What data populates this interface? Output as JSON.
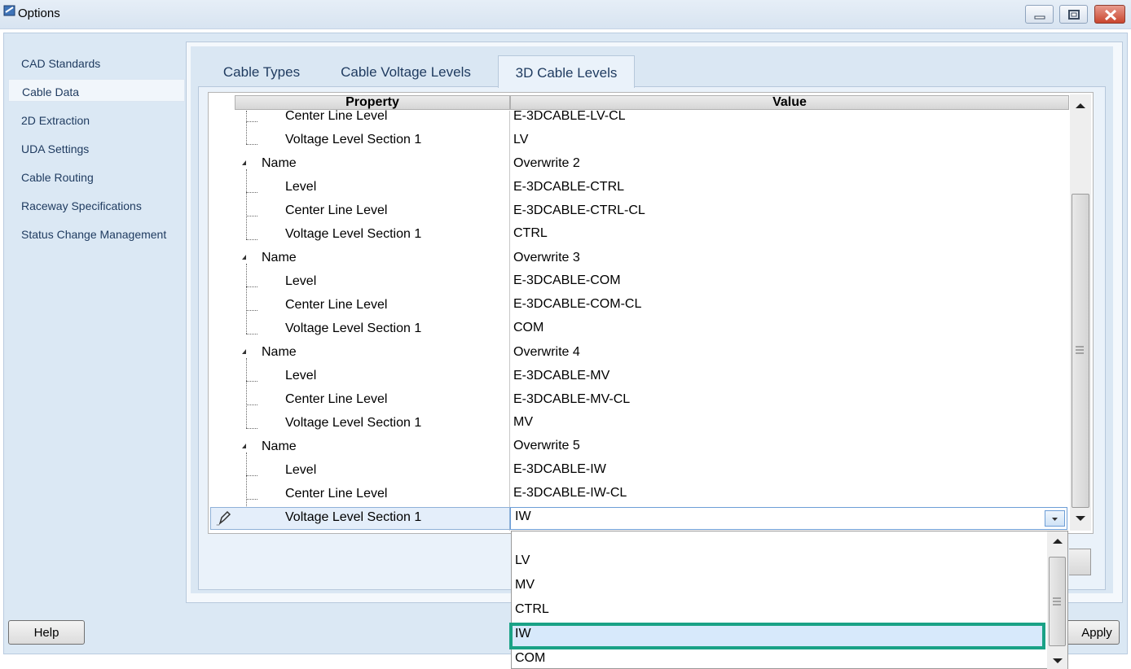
{
  "window": {
    "title": "Options",
    "icon": "app-icon",
    "controls": [
      "minimize-icon",
      "maximize-icon",
      "close-icon"
    ]
  },
  "nav": {
    "items": [
      {
        "label": "CAD Standards",
        "selected": false
      },
      {
        "label": "Cable Data",
        "selected": true
      },
      {
        "label": "2D Extraction",
        "selected": false
      },
      {
        "label": "UDA Settings",
        "selected": false
      },
      {
        "label": "Cable Routing",
        "selected": false
      },
      {
        "label": "Raceway Specifications",
        "selected": false
      },
      {
        "label": "Status Change Management",
        "selected": false
      }
    ]
  },
  "tabs": [
    {
      "label": "Cable Types",
      "active": false
    },
    {
      "label": "Cable Voltage Levels",
      "active": false
    },
    {
      "label": "3D Cable Levels",
      "active": true
    }
  ],
  "grid": {
    "headers": {
      "property": "Property",
      "value": "Value"
    },
    "rows": [
      {
        "property": "Center Line Level",
        "value": "E-3DCABLE-LV-CL"
      },
      {
        "property": "Voltage Level Section 1",
        "value": "LV"
      },
      {
        "property": "Name",
        "value": "Overwrite 2"
      },
      {
        "property": "Level",
        "value": "E-3DCABLE-CTRL"
      },
      {
        "property": "Center Line Level",
        "value": "E-3DCABLE-CTRL-CL"
      },
      {
        "property": "Voltage Level Section 1",
        "value": "CTRL"
      },
      {
        "property": "Name",
        "value": "Overwrite 3"
      },
      {
        "property": "Level",
        "value": "E-3DCABLE-COM"
      },
      {
        "property": "Center Line Level",
        "value": "E-3DCABLE-COM-CL"
      },
      {
        "property": "Voltage Level Section 1",
        "value": "COM"
      },
      {
        "property": "Name",
        "value": "Overwrite 4"
      },
      {
        "property": "Level",
        "value": "E-3DCABLE-MV"
      },
      {
        "property": "Center Line Level",
        "value": "E-3DCABLE-MV-CL"
      },
      {
        "property": "Voltage Level Section 1",
        "value": "MV"
      },
      {
        "property": "Name",
        "value": "Overwrite 5"
      },
      {
        "property": "Level",
        "value": "E-3DCABLE-IW"
      },
      {
        "property": "Center Line Level",
        "value": "E-3DCABLE-IW-CL"
      }
    ],
    "edit_row": {
      "property": "Voltage Level Section 1",
      "value": "IW"
    }
  },
  "dropdown": {
    "options": [
      "",
      "LV",
      "MV",
      "CTRL",
      "IW",
      "COM"
    ],
    "highlighted": "IW"
  },
  "buttons": {
    "help": "Help",
    "apply": "Apply"
  },
  "colors": {
    "highlight_border": "#1aa286",
    "panel_bg": "#dae7f3"
  }
}
